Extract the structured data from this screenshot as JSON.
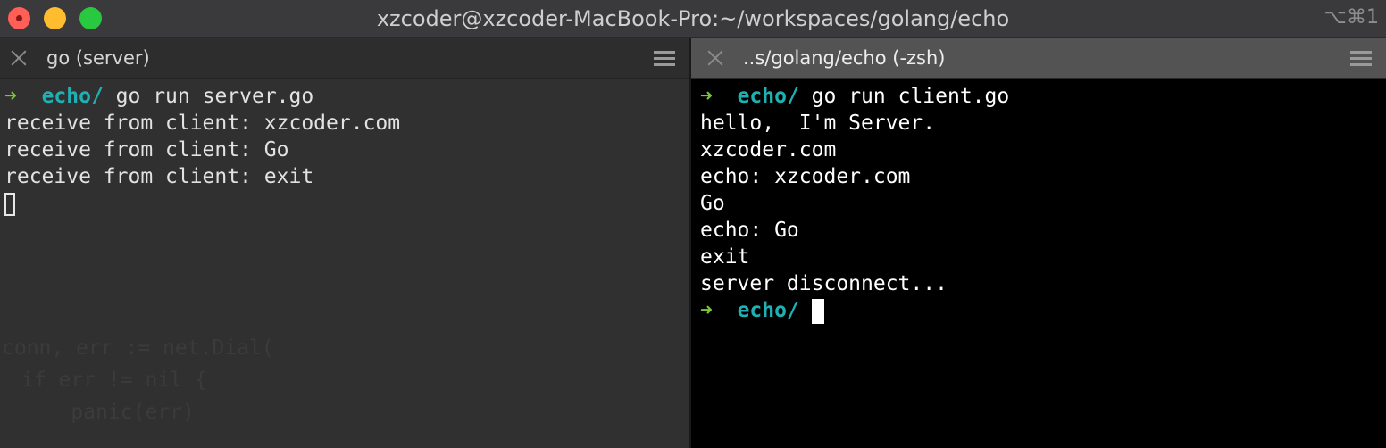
{
  "window": {
    "title": "xzcoder@xzcoder-MacBook-Pro:~/workspaces/golang/echo",
    "shortcut": "⌥⌘1",
    "colors": {
      "close": "#ff5f57",
      "minimize": "#febc2e",
      "maximize": "#28c840"
    }
  },
  "left_pane": {
    "tab_title": "go (server)",
    "prompt": {
      "arrow": "➜",
      "dir": "echo/",
      "command": "go run server.go"
    },
    "output": [
      "receive from client: xzcoder.com",
      "receive from client: Go",
      "receive from client: exit"
    ],
    "ghost_lines": [
      "conn, err := net.Dial(",
      "if err != nil {",
      "    panic(err)"
    ]
  },
  "right_pane": {
    "tab_title": "..s/golang/echo (-zsh)",
    "prompt": {
      "arrow": "➜",
      "dir": "echo/",
      "command": "go run client.go"
    },
    "output": [
      "hello,  I'm Server.",
      "xzcoder.com",
      "echo: xzcoder.com",
      "Go",
      "echo: Go",
      "exit",
      "server disconnect..."
    ],
    "final_prompt": {
      "arrow": "➜",
      "dir": "echo/"
    }
  },
  "colors": {
    "prompt_arrow": "#7cc43a",
    "prompt_dir": "#1fb0b3"
  }
}
